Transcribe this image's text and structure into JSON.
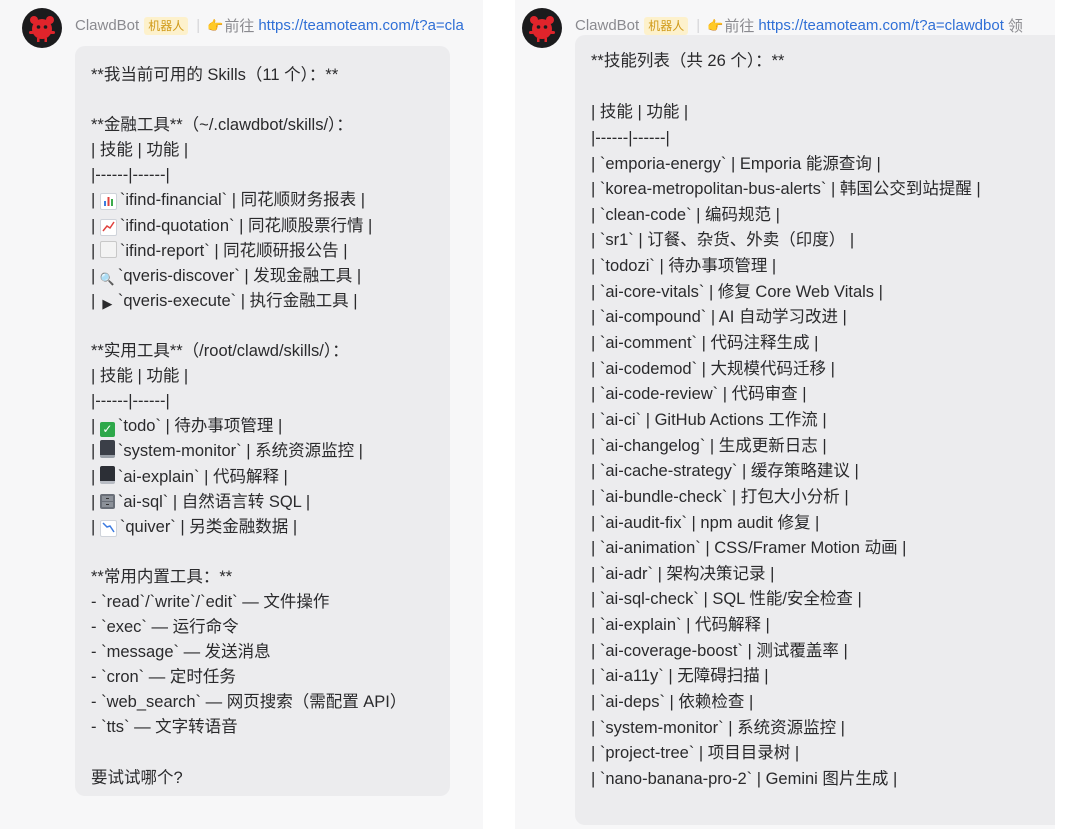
{
  "bot": {
    "name": "ClawdBot",
    "badge": "机器人",
    "goto": "前往",
    "link": "https://teamoteam.com/t?a=cla"
  },
  "bot_right": {
    "name": "ClawdBot",
    "badge": "机器人",
    "goto": "前往",
    "link": "https://teamoteam.com/t?a=clawdbot",
    "extra": "领"
  },
  "left": {
    "title": "**我当前可用的 Skills（11 个）：**",
    "finance_heading": "**金融工具**（~/.clawdbot/skills/）：",
    "table_header": "| 技能 | 功能 |",
    "table_sep": "|------|------|",
    "finance": [
      {
        "icon": "bar-chart-icon",
        "pre": "| ",
        "text": "`ifind-financial` | 同花顺财务报表 |"
      },
      {
        "icon": "line-chart-icon",
        "pre": "| ",
        "text": "`ifind-quotation` | 同花顺股票行情 |"
      },
      {
        "icon": "document-icon",
        "pre": "| ",
        "text": "`ifind-report` | 同花顺研报公告 |"
      },
      {
        "icon": "magnifier-icon",
        "pre": "| ",
        "text": "`qveris-discover` | 发现金融工具 |"
      },
      {
        "icon": "play-icon",
        "pre": "| ",
        "text": "`qveris-execute` | 执行金融工具 |"
      }
    ],
    "util_heading": "**实用工具**（/root/clawd/skills/）：",
    "util": [
      {
        "icon": "check-icon",
        "pre": "| ",
        "text": "`todo` | 待办事项管理 |"
      },
      {
        "icon": "monitor-icon",
        "pre": "| ",
        "text": "`system-monitor` | 系统资源监控 |"
      },
      {
        "icon": "laptop-icon",
        "pre": "| ",
        "text": "`ai-explain` | 代码解释 |"
      },
      {
        "icon": "cabinet-icon",
        "pre": "| ",
        "text": "`ai-sql` | 自然语言转 SQL |"
      },
      {
        "icon": "down-chart-icon",
        "pre": "| ",
        "text": "`quiver` | 另类金融数据 |"
      }
    ],
    "builtin_heading": "**常用内置工具：**",
    "builtin": [
      "- `read`/`write`/`edit` — 文件操作",
      "- `exec` — 运行命令",
      "- `message` — 发送消息",
      "- `cron` — 定时任务",
      "- `web_search` — 网页搜索（需配置 API）",
      "- `tts` — 文字转语音"
    ],
    "closing": "要试试哪个?"
  },
  "right": {
    "title": "**技能列表（共 26 个）：**",
    "table_header": "| 技能 | 功能 |",
    "table_sep": "|------|------|",
    "rows": [
      "| `emporia-energy` | Emporia 能源查询 |",
      "| `korea-metropolitan-bus-alerts` | 韩国公交到站提醒 |",
      "| `clean-code` | 编码规范 |",
      "| `sr1` | 订餐、杂货、外卖（印度） |",
      "| `todozi` | 待办事项管理 |",
      "| `ai-core-vitals` | 修复 Core Web Vitals |",
      "| `ai-compound` | AI 自动学习改进 |",
      "| `ai-comment` | 代码注释生成 |",
      "| `ai-codemod` | 大规模代码迁移 |",
      "| `ai-code-review` | 代码审查 |",
      "| `ai-ci` | GitHub Actions 工作流 |",
      "| `ai-changelog` | 生成更新日志 |",
      "| `ai-cache-strategy` | 缓存策略建议 |",
      "| `ai-bundle-check` | 打包大小分析 |",
      "| `ai-audit-fix` | npm audit 修复 |",
      "| `ai-animation` | CSS/Framer Motion 动画 |",
      "| `ai-adr` | 架构决策记录 |",
      "| `ai-sql-check` | SQL 性能/安全检查 |",
      "| `ai-explain` | 代码解释 |",
      "| `ai-coverage-boost` | 测试覆盖率 |",
      "| `ai-a11y` | 无障碍扫描 |",
      "| `ai-deps` | 依赖检查 |",
      "| `system-monitor` | 系统资源监控 |",
      "| `project-tree` | 项目目录树 |",
      "| `nano-banana-pro-2` | Gemini 图片生成 |"
    ]
  }
}
